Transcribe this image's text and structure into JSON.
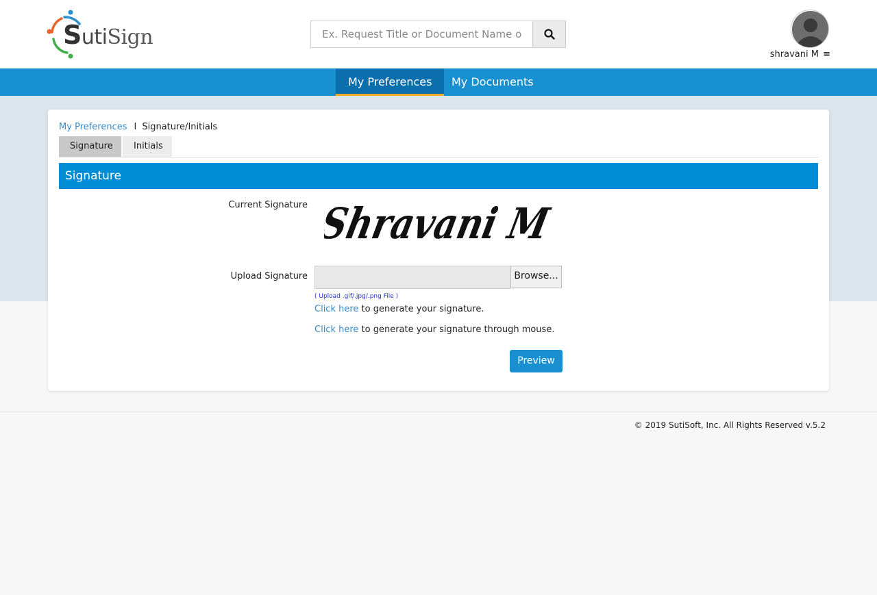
{
  "brand": {
    "logo_text_prefix": "S",
    "logo_text_mid": "uti",
    "logo_text_suffix": "Sign",
    "colors": {
      "primary": "#1890d0",
      "nav_active": "#0b6fae",
      "nav_indicator": "#f5a623",
      "section_header": "#008dd5"
    }
  },
  "search": {
    "placeholder": "Ex. Request Title or Document Name or Sender",
    "button_icon": "search-icon"
  },
  "user": {
    "name": "shravani M",
    "menu_icon": "≡"
  },
  "nav": {
    "tabs": [
      {
        "label": "My Preferences",
        "active": true
      },
      {
        "label": "My Documents",
        "active": false
      }
    ]
  },
  "breadcrumb": {
    "parent": "My Preferences",
    "separator": "I",
    "current": "Signature/Initials"
  },
  "subtabs": [
    {
      "label": "Signature",
      "active": true
    },
    {
      "label": "Initials",
      "active": false
    }
  ],
  "section": {
    "title": "Signature",
    "current_signature_label": "Current Signature",
    "current_signature_text": "Shravani M",
    "upload_label": "Upload Signature",
    "browse_label": "Browse...",
    "upload_hint": "( Upload .gif/.jpg/.png File )",
    "generate_link": "Click here",
    "generate_text": " to generate your signature.",
    "mouse_link": "Click here",
    "mouse_text": " to generate your signature through mouse.",
    "preview_label": "Preview"
  },
  "footer": {
    "copyright": "© 2019 SutiSoft, Inc. All Rights Reserved v.5.2"
  }
}
